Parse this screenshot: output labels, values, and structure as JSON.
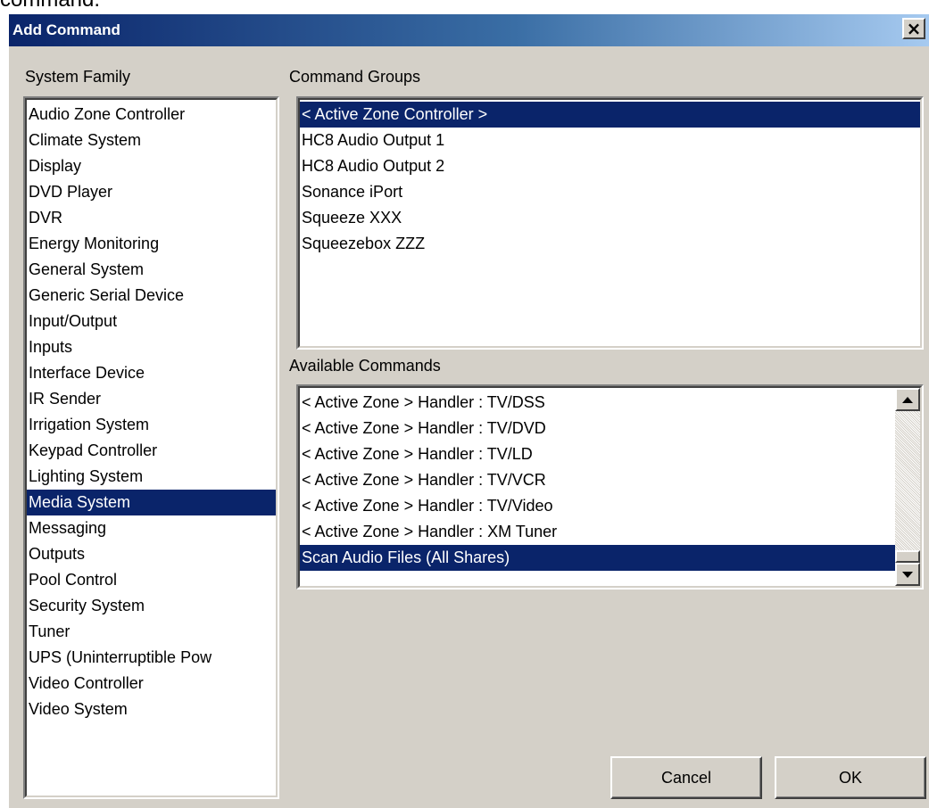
{
  "header_text": "command.",
  "window": {
    "title": "Add Command",
    "close_glyph": "×"
  },
  "system_family": {
    "label": "System Family",
    "items": [
      "Audio Zone Controller",
      "Climate System",
      "Display",
      "DVD Player",
      "DVR",
      "Energy Monitoring",
      "General System",
      "Generic Serial Device",
      "Input/Output",
      "Inputs",
      "Interface Device",
      "IR Sender",
      "Irrigation System",
      "Keypad Controller",
      "Lighting System",
      "Media System",
      "Messaging",
      "Outputs",
      "Pool Control",
      "Security System",
      "Tuner",
      "UPS (Uninterruptible Pow",
      "Video Controller",
      "Video System"
    ],
    "selected": "Media System"
  },
  "command_groups": {
    "label": "Command Groups",
    "items": [
      "< Active Zone Controller >",
      "HC8 Audio Output 1",
      "HC8 Audio Output 2",
      "Sonance iPort",
      "Squeeze XXX",
      "Squeezebox ZZZ"
    ],
    "selected": "< Active Zone Controller >"
  },
  "available_commands": {
    "label": "Available Commands",
    "items": [
      "< Active Zone > Handler : TV/DSS",
      "< Active Zone > Handler : TV/DVD",
      "< Active Zone > Handler : TV/LD",
      "< Active Zone > Handler : TV/VCR",
      "< Active Zone > Handler : TV/Video",
      "< Active Zone > Handler : XM Tuner",
      "Scan Audio Files (All Shares)"
    ],
    "selected": "Scan Audio Files (All Shares)",
    "scroll_position": 1.0
  },
  "buttons": {
    "cancel": "Cancel",
    "ok": "OK"
  },
  "colors": {
    "selection": "#0a246a",
    "dialog_bg": "#d4d0c8",
    "titlebar_start": "#0a246a",
    "titlebar_end": "#a6caf0"
  }
}
